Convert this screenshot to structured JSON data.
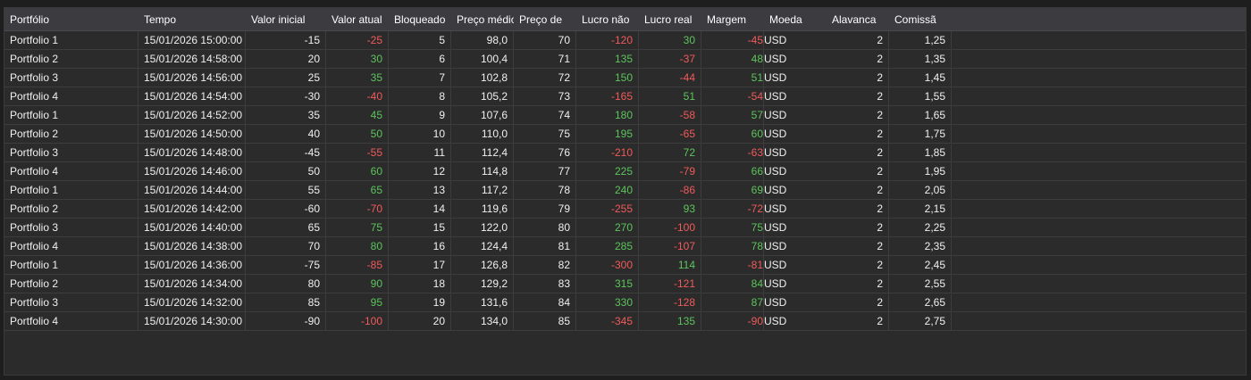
{
  "table": {
    "columns": [
      "Portfólio",
      "Tempo",
      "Valor inicial",
      "Valor atual",
      "Bloqueado",
      "Preço médio",
      "Preço de",
      "Lucro não",
      "Lucro real",
      "Margem",
      "Moeda",
      "Alavanca",
      "Comissã"
    ],
    "colors": {
      "positive": "#5cc55c",
      "negative": "#f25a5a"
    },
    "rows": [
      [
        "Portfolio 1",
        "15/01/2026 15:00:00",
        "-15",
        "-25",
        "5",
        "98,0",
        "70",
        "-120",
        "30",
        "-45",
        "USD",
        "2",
        "1,25"
      ],
      [
        "Portfolio 2",
        "15/01/2026 14:58:00",
        "20",
        "30",
        "6",
        "100,4",
        "71",
        "135",
        "-37",
        "48",
        "USD",
        "2",
        "1,35"
      ],
      [
        "Portfolio 3",
        "15/01/2026 14:56:00",
        "25",
        "35",
        "7",
        "102,8",
        "72",
        "150",
        "-44",
        "51",
        "USD",
        "2",
        "1,45"
      ],
      [
        "Portfolio 4",
        "15/01/2026 14:54:00",
        "-30",
        "-40",
        "8",
        "105,2",
        "73",
        "-165",
        "51",
        "-54",
        "USD",
        "2",
        "1,55"
      ],
      [
        "Portfolio 1",
        "15/01/2026 14:52:00",
        "35",
        "45",
        "9",
        "107,6",
        "74",
        "180",
        "-58",
        "57",
        "USD",
        "2",
        "1,65"
      ],
      [
        "Portfolio 2",
        "15/01/2026 14:50:00",
        "40",
        "50",
        "10",
        "110,0",
        "75",
        "195",
        "-65",
        "60",
        "USD",
        "2",
        "1,75"
      ],
      [
        "Portfolio 3",
        "15/01/2026 14:48:00",
        "-45",
        "-55",
        "11",
        "112,4",
        "76",
        "-210",
        "72",
        "-63",
        "USD",
        "2",
        "1,85"
      ],
      [
        "Portfolio 4",
        "15/01/2026 14:46:00",
        "50",
        "60",
        "12",
        "114,8",
        "77",
        "225",
        "-79",
        "66",
        "USD",
        "2",
        "1,95"
      ],
      [
        "Portfolio 1",
        "15/01/2026 14:44:00",
        "55",
        "65",
        "13",
        "117,2",
        "78",
        "240",
        "-86",
        "69",
        "USD",
        "2",
        "2,05"
      ],
      [
        "Portfolio 2",
        "15/01/2026 14:42:00",
        "-60",
        "-70",
        "14",
        "119,6",
        "79",
        "-255",
        "93",
        "-72",
        "USD",
        "2",
        "2,15"
      ],
      [
        "Portfolio 3",
        "15/01/2026 14:40:00",
        "65",
        "75",
        "15",
        "122,0",
        "80",
        "270",
        "-100",
        "75",
        "USD",
        "2",
        "2,25"
      ],
      [
        "Portfolio 4",
        "15/01/2026 14:38:00",
        "70",
        "80",
        "16",
        "124,4",
        "81",
        "285",
        "-107",
        "78",
        "USD",
        "2",
        "2,35"
      ],
      [
        "Portfolio 1",
        "15/01/2026 14:36:00",
        "-75",
        "-85",
        "17",
        "126,8",
        "82",
        "-300",
        "114",
        "-81",
        "USD",
        "2",
        "2,45"
      ],
      [
        "Portfolio 2",
        "15/01/2026 14:34:00",
        "80",
        "90",
        "18",
        "129,2",
        "83",
        "315",
        "-121",
        "84",
        "USD",
        "2",
        "2,55"
      ],
      [
        "Portfolio 3",
        "15/01/2026 14:32:00",
        "85",
        "95",
        "19",
        "131,6",
        "84",
        "330",
        "-128",
        "87",
        "USD",
        "2",
        "2,65"
      ],
      [
        "Portfolio 4",
        "15/01/2026 14:30:00",
        "-90",
        "-100",
        "20",
        "134,0",
        "85",
        "-345",
        "135",
        "-90",
        "USD",
        "2",
        "2,75"
      ]
    ]
  }
}
